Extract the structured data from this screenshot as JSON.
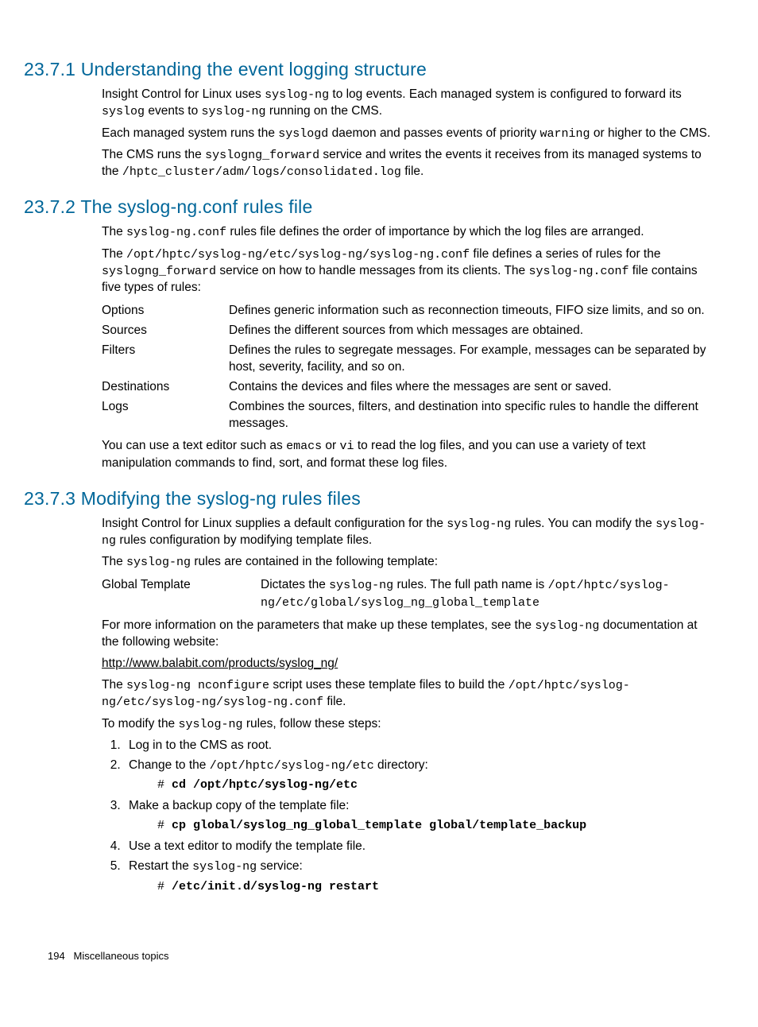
{
  "s1": {
    "heading": "23.7.1 Understanding the event logging structure",
    "p1a": "Insight Control for Linux uses ",
    "p1b": "syslog-ng",
    "p1c": " to log events. Each managed system is configured to forward its ",
    "p1d": "syslog",
    "p1e": " events to ",
    "p1f": "syslog-ng",
    "p1g": " running on the CMS.",
    "p2a": "Each managed system runs the ",
    "p2b": "syslogd",
    "p2c": " daemon and passes events of priority ",
    "p2d": "warning",
    "p2e": " or higher to the CMS.",
    "p3a": "The CMS runs the ",
    "p3b": "syslogng_forward",
    "p3c": " service and writes the events it receives from its managed systems to the ",
    "p3d": "/hptc_cluster/adm/logs/consolidated.log",
    "p3e": " file."
  },
  "s2": {
    "heading": "23.7.2 The syslog-ng.conf rules file",
    "p1a": "The ",
    "p1b": "syslog-ng.conf",
    "p1c": " rules file defines the order of importance by which the log files are arranged.",
    "p2a": "The ",
    "p2b": "/opt/hptc/syslog-ng/etc/syslog-ng/syslog-ng.conf",
    "p2c": " file defines a series of rules for the ",
    "p2d": "syslogng_forward",
    "p2e": " service on how to handle messages from its clients. The ",
    "p2f": "syslog-ng.conf",
    "p2g": " file contains five types of rules:",
    "rules": [
      {
        "term": "Options",
        "def": "Defines generic information such as reconnection timeouts, FIFO size limits, and so on."
      },
      {
        "term": "Sources",
        "def": "Defines the different sources from which messages are obtained."
      },
      {
        "term": "Filters",
        "def": "Defines the rules to segregate messages. For example, messages can be separated by host, severity, facility, and so on."
      },
      {
        "term": "Destinations",
        "def": "Contains the devices and files where the messages are sent or saved."
      },
      {
        "term": "Logs",
        "def": "Combines the sources, filters, and destination into specific rules to handle the different messages."
      }
    ],
    "p3a": "You can use a text editor such as ",
    "p3b": "emacs",
    "p3c": " or ",
    "p3d": "vi",
    "p3e": " to read the log files, and you can use a variety of text manipulation commands to find, sort, and format these log files."
  },
  "s3": {
    "heading": "23.7.3 Modifying the syslog-ng rules files",
    "p1a": "Insight Control for Linux supplies a default configuration for the ",
    "p1b": "syslog-ng",
    "p1c": " rules. You can modify the ",
    "p1d": "syslog-ng",
    "p1e": " rules configuration by modifying template files.",
    "p2a": "The ",
    "p2b": "syslog-ng",
    "p2c": " rules are contained in the following template:",
    "tpl_term": "Global Template",
    "tpl_a": "Dictates the ",
    "tpl_b": "syslog-ng",
    "tpl_c": " rules. The full path name is ",
    "tpl_d": "/opt/hptc/syslog-ng/etc/global/syslog_ng_global_template",
    "p3a": "For more information on the parameters that make up these templates, see the ",
    "p3b": "syslog-ng",
    "p3c": " documentation at the following website:",
    "link": "http://www.balabit.com/products/syslog_ng/",
    "p4a": "The ",
    "p4b": "syslog-ng nconfigure",
    "p4c": " script uses these template files to build the ",
    "p4d": "/opt/hptc/syslog-ng/etc/syslog-ng/syslog-ng.conf",
    "p4e": " file.",
    "p5a": "To modify the ",
    "p5b": "syslog-ng",
    "p5c": " rules, follow these steps:",
    "step1": "Log in to the CMS as root.",
    "step2a": "Change to the ",
    "step2b": "/opt/hptc/syslog-ng/etc",
    "step2c": " directory:",
    "cmd2_prompt": "# ",
    "cmd2": "cd /opt/hptc/syslog-ng/etc",
    "step3": "Make a backup copy of the template file:",
    "cmd3_prompt": "# ",
    "cmd3": "cp global/syslog_ng_global_template global/template_backup",
    "step4": "Use a text editor to modify the template file.",
    "step5a": "Restart the ",
    "step5b": "syslog-ng",
    "step5c": " service:",
    "cmd5_prompt": "# ",
    "cmd5": "/etc/init.d/syslog-ng restart"
  },
  "footer": {
    "page": "194",
    "title": "Miscellaneous topics"
  }
}
